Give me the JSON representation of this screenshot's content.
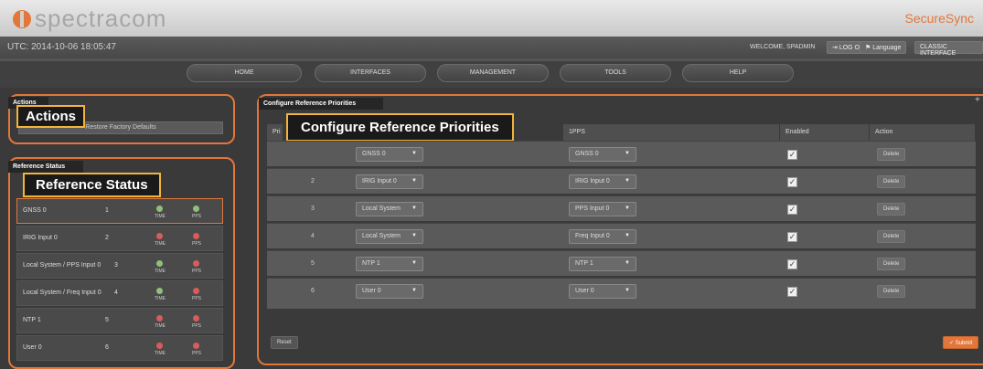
{
  "header": {
    "logo": "spectracom",
    "brand": "SecureSync"
  },
  "status": {
    "utc": "UTC: 2014-10-06 18:05:47",
    "welcome": "WELCOME, SPADMIN",
    "logout": "LOG OUT",
    "language": "Language",
    "classic": "CLASSIC INTERFACE"
  },
  "nav": [
    "HOME",
    "INTERFACES",
    "MANAGEMENT",
    "TOOLS",
    "HELP"
  ],
  "actions": {
    "title": "Actions",
    "callout": "Actions",
    "restore": "Restore Factory Defaults"
  },
  "reference_status": {
    "title": "Reference Status",
    "callout": "Reference Status",
    "time_label": "TIME",
    "pps_label": "PPS",
    "rows": [
      {
        "name": "GNSS 0",
        "priority": "1",
        "time": "green",
        "pps": "green"
      },
      {
        "name": "IRIG Input 0",
        "priority": "2",
        "time": "red",
        "pps": "red"
      },
      {
        "name": "Local System / PPS Input 0",
        "priority": "3",
        "time": "green",
        "pps": "red"
      },
      {
        "name": "Local System / Freq Input 0",
        "priority": "4",
        "time": "green",
        "pps": "red"
      },
      {
        "name": "NTP 1",
        "priority": "5",
        "time": "red",
        "pps": "red"
      },
      {
        "name": "User 0",
        "priority": "6",
        "time": "red",
        "pps": "red"
      }
    ]
  },
  "priorities": {
    "title": "Configure Reference Priorities",
    "callout": "Configure Reference Priorities",
    "columns": {
      "priority": "Pri",
      "pps": "1PPS",
      "enabled": "Enabled",
      "action": "Action"
    },
    "rows": [
      {
        "priority": "",
        "time": "GNSS 0",
        "pps": "GNSS 0",
        "enabled": true
      },
      {
        "priority": "2",
        "time": "IRIG Input 0",
        "pps": "IRIG Input 0",
        "enabled": true
      },
      {
        "priority": "3",
        "time": "Local System",
        "pps": "PPS Input 0",
        "enabled": true
      },
      {
        "priority": "4",
        "time": "Local System",
        "pps": "Freq Input 0",
        "enabled": true
      },
      {
        "priority": "5",
        "time": "NTP 1",
        "pps": "NTP 1",
        "enabled": true
      },
      {
        "priority": "6",
        "time": "User 0",
        "pps": "User 0",
        "enabled": true
      }
    ],
    "delete_label": "Delete",
    "reset_label": "Reset",
    "submit_label": "✓ Submit"
  },
  "colors": {
    "accent": "#e2763b",
    "callout_border": "#f2b43a",
    "led_green": "#8fc07a",
    "led_red": "#d95b5b"
  }
}
